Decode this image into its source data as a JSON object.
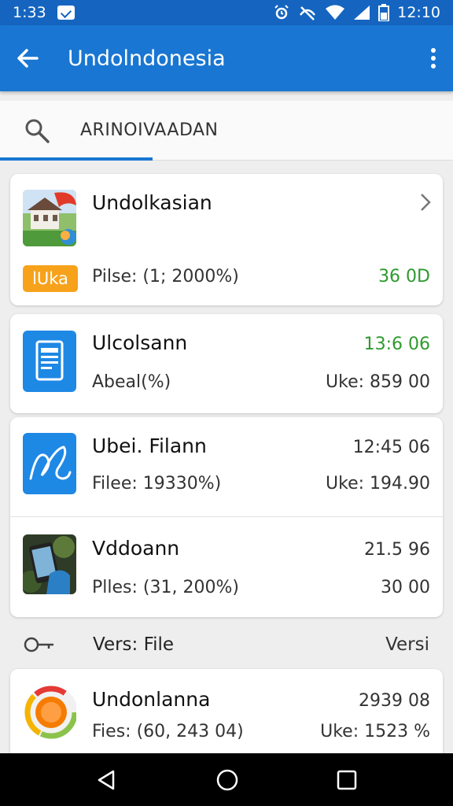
{
  "status_bar": {
    "time": "1:33",
    "clock": "12:10"
  },
  "app_bar": {
    "title": "Undolndonesia"
  },
  "search": {
    "query": "ARINOIVAADAN"
  },
  "cards": [
    {
      "name": "Undolkasian",
      "badge": "lUka",
      "sub": "Pilse: (1; 2000%)",
      "right_bottom": "36 0D"
    },
    {
      "name": "Ulcolsann",
      "right_top": "13:6 06",
      "sub": "Abeal(%)",
      "right_bottom": "Uke: 859 00"
    },
    {
      "name": "Ubei. Filann",
      "right_top": "12:45 06",
      "sub": "Filee: 19330%)",
      "right_bottom": "Uke: 194.90"
    },
    {
      "name": "Vddoann",
      "right_top": "21.5 96",
      "sub": "Plles: (31, 200%)",
      "right_bottom": "30 00"
    },
    {
      "name": "Undonlanna",
      "right_top": "2939 08",
      "sub": "Fies: (60, 243 04)",
      "right_bottom": "Uke: 1523 %"
    }
  ],
  "section": {
    "label": "Vers: File",
    "action": "Versi"
  },
  "colors": {
    "primary": "#1976d2",
    "status": "#1565c0",
    "green": "#2e9a2e",
    "badge": "#f7a21b"
  }
}
